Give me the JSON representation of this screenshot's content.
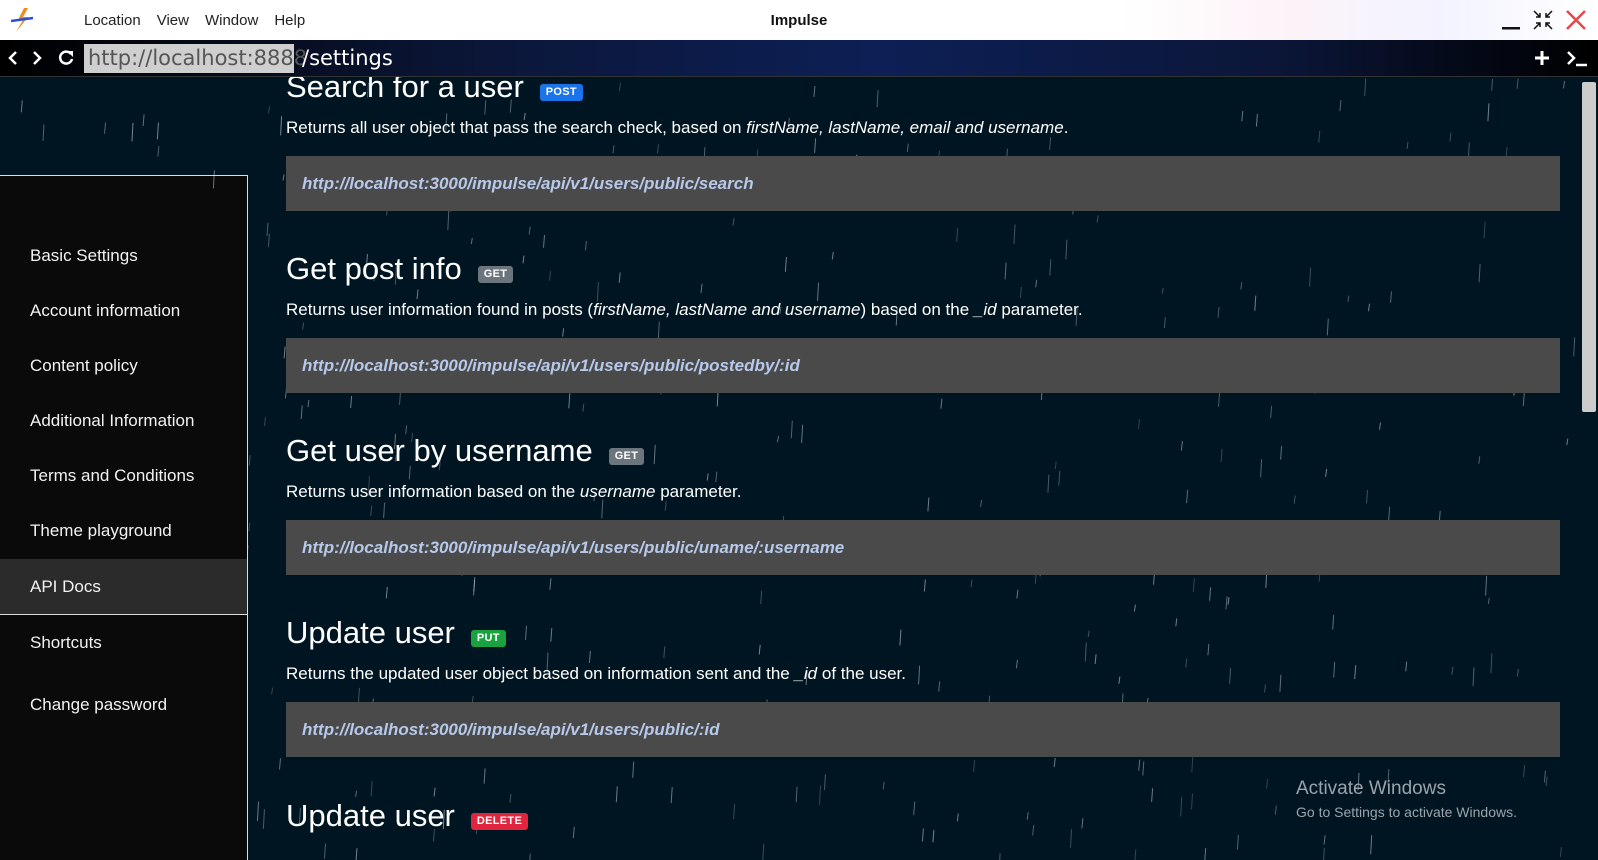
{
  "window": {
    "title": "Impulse",
    "menu": [
      "Location",
      "View",
      "Window",
      "Help"
    ]
  },
  "address_bar": {
    "host": "http://localhost:8888",
    "path": "/settings"
  },
  "sidebar": {
    "items": [
      {
        "label": "Basic Settings"
      },
      {
        "label": "Account information"
      },
      {
        "label": "Content policy"
      },
      {
        "label": "Additional Information"
      },
      {
        "label": "Terms and Conditions"
      },
      {
        "label": "Theme playground"
      },
      {
        "label": "API Docs",
        "active": true
      },
      {
        "label": "Shortcuts"
      },
      {
        "label": "Change password"
      }
    ]
  },
  "endpoints": [
    {
      "title": "Search for a user",
      "method": "POST",
      "desc_parts": [
        "Returns all user object that pass the search check, based on ",
        "firstName, lastName, email and username",
        "."
      ],
      "url": "http://localhost:3000/impulse/api/v1/users/public/search"
    },
    {
      "title": "Get post info",
      "method": "GET",
      "desc_parts": [
        "Returns user information found in posts (",
        "firstName, lastName and username",
        ") based on the ",
        "_id",
        " parameter."
      ],
      "url": "http://localhost:3000/impulse/api/v1/users/public/postedby/:id"
    },
    {
      "title": "Get user by username",
      "method": "GET",
      "desc_parts": [
        "Returns user information based on the ",
        "username",
        " parameter."
      ],
      "url": "http://localhost:3000/impulse/api/v1/users/public/uname/:username"
    },
    {
      "title": "Update user",
      "method": "PUT",
      "desc_parts": [
        "Returns the updated user object based on information sent and the ",
        "_id",
        " of the user."
      ],
      "url": "http://localhost:3000/impulse/api/v1/users/public/:id"
    },
    {
      "title": "Update user",
      "method": "DELETE"
    }
  ],
  "watermark": {
    "title": "Activate Windows",
    "subtitle": "Go to Settings to activate Windows."
  },
  "colors": {
    "background": "#001522",
    "sidebar_panel": "#0a0a0a",
    "code_block": "#4a4a4a",
    "badge_post": "#1a73e8",
    "badge_get": "#6c757d",
    "badge_put": "#18a340",
    "badge_delete": "#e0253c"
  }
}
